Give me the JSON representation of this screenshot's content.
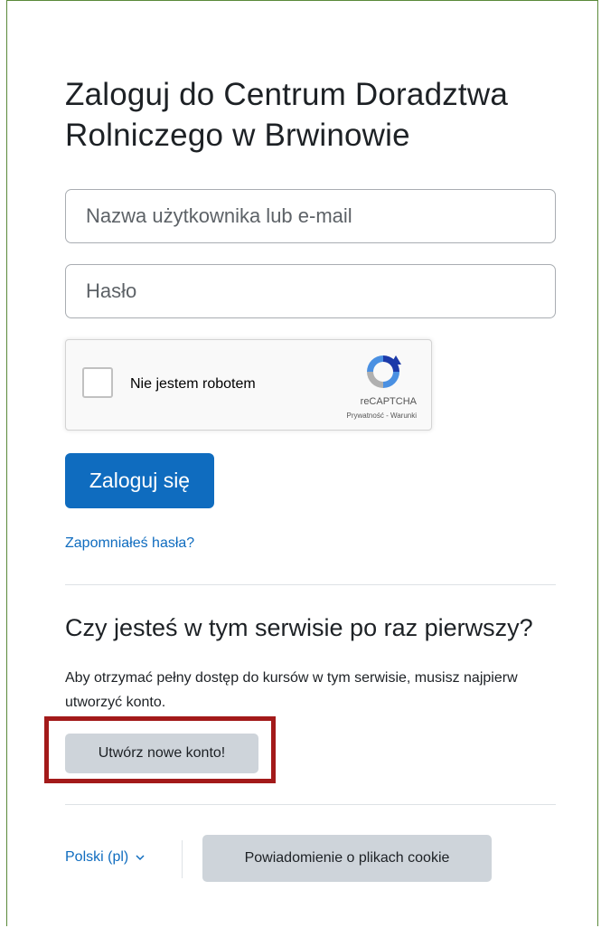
{
  "login": {
    "title": "Zaloguj do Centrum Doradztwa Rolniczego w Brwinowie",
    "username_placeholder": "Nazwa użytkownika lub e-mail",
    "password_placeholder": "Hasło",
    "submit_label": "Zaloguj się",
    "forgot_password": "Zapomniałeś hasła?"
  },
  "recaptcha": {
    "label": "Nie jestem robotem",
    "brand": "reCAPTCHA",
    "privacy": "Prywatność",
    "separator": " - ",
    "terms": "Warunki"
  },
  "signup": {
    "heading": "Czy jesteś w tym serwisie po raz pierwszy?",
    "description": "Aby otrzymać pełny dostęp do kursów w tym serwisie, musisz najpierw utworzyć konto.",
    "create_button": "Utwórz nowe konto!"
  },
  "footer": {
    "language": "Polski ‎(pl)‎",
    "cookie_button": "Powiadomienie o plikach cookie"
  },
  "colors": {
    "primary": "#0f6cbf",
    "highlight": "#a31a1a",
    "frame": "#5a8a3a",
    "secondary_button": "#ced4da"
  }
}
